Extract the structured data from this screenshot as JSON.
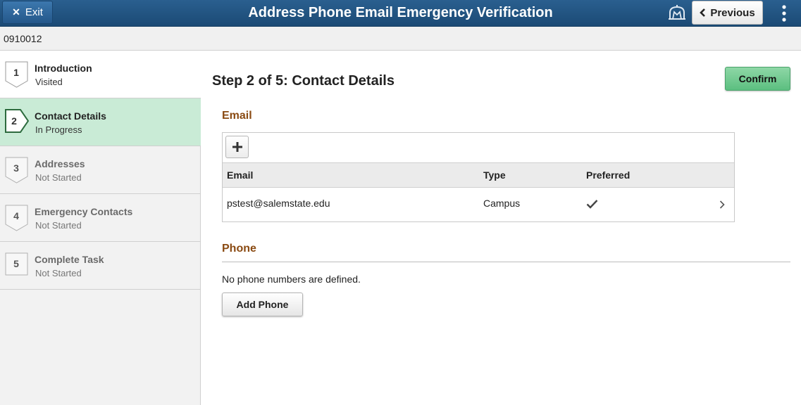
{
  "header": {
    "exit_label": "Exit",
    "title": "Address Phone Email Emergency Verification",
    "previous_label": "Previous",
    "notification_icon": "notification-flag-icon",
    "more_icon": "more-options-icon"
  },
  "subheader": {
    "id": "0910012"
  },
  "steps": [
    {
      "number": "1",
      "label": "Introduction",
      "status": "Visited"
    },
    {
      "number": "2",
      "label": "Contact Details",
      "status": "In Progress"
    },
    {
      "number": "3",
      "label": "Addresses",
      "status": "Not Started"
    },
    {
      "number": "4",
      "label": "Emergency Contacts",
      "status": "Not Started"
    },
    {
      "number": "5",
      "label": "Complete Task",
      "status": "Not Started"
    }
  ],
  "main": {
    "page_title": "Step 2 of 5: Contact Details",
    "confirm_label": "Confirm",
    "email": {
      "section_title": "Email",
      "columns": [
        "Email",
        "Type",
        "Preferred"
      ],
      "rows": [
        {
          "email": "pstest@salemstate.edu",
          "type": "Campus",
          "preferred": true
        }
      ]
    },
    "phone": {
      "section_title": "Phone",
      "empty_text": "No phone numbers are defined.",
      "add_label": "Add Phone"
    }
  },
  "colors": {
    "header": "#1f4f7d",
    "current_step": "#c9ebd6",
    "confirm_button": "#6cc88e",
    "section_title": "#8a4a12"
  }
}
